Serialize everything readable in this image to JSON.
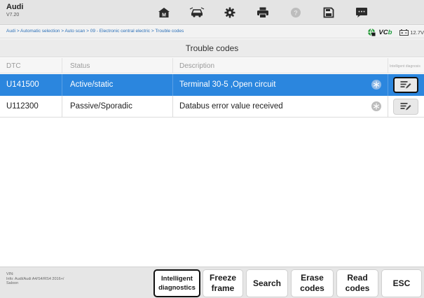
{
  "header": {
    "title": "Audi",
    "version": "V7.20",
    "tools": [
      {
        "name": "home-icon"
      },
      {
        "name": "vehicle-swap-icon"
      },
      {
        "name": "settings-icon"
      },
      {
        "name": "print-icon"
      },
      {
        "name": "help-icon"
      },
      {
        "name": "save-icon"
      },
      {
        "name": "message-icon"
      }
    ]
  },
  "breadcrumb": {
    "path": "Audi > Automatic selection > Auto scan > 09 - Electronic central electric > Trouble codes",
    "vci_prefix": "VC",
    "vci_suffix": "b",
    "battery": "12.7V"
  },
  "page_title": "Trouble codes",
  "table": {
    "headers": {
      "dtc": "DTC",
      "status": "Status",
      "description": "Description",
      "intelligent": "Intelligent diagnosis"
    },
    "rows": [
      {
        "dtc": "U141500",
        "status": "Active/static",
        "description": "Terminal 30-5 ,Open circuit",
        "selected": true
      },
      {
        "dtc": "U112300",
        "status": "Passive/Sporadic",
        "description": "Databus error value received",
        "selected": false
      }
    ]
  },
  "footer": {
    "vin_label": "VIN:",
    "info_line1": "Info: Audi/Audi A4/S4/RS4 2016+/",
    "info_line2": "Saloon",
    "buttons": {
      "intelligent_1": "Intelligent",
      "intelligent_2": "diagnostics",
      "freeze_1": "Freeze",
      "freeze_2": "frame",
      "search": "Search",
      "erase_1": "Erase",
      "erase_2": "codes",
      "read_1": "Read",
      "read_2": "codes",
      "esc": "ESC"
    }
  },
  "colors": {
    "selected_row": "#2b86de",
    "link": "#2a6fb8",
    "vci_green": "#1e9b3c"
  }
}
